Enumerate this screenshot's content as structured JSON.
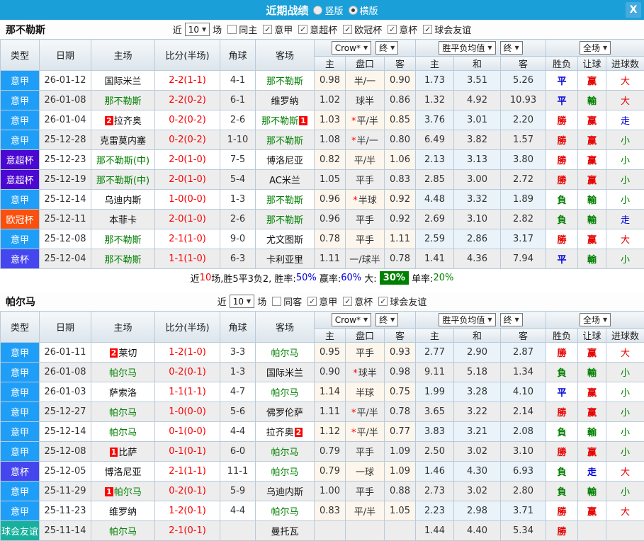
{
  "topbar": {
    "title": "近期战绩",
    "radios": [
      {
        "label": "竖版",
        "checked": false
      },
      {
        "label": "横版",
        "checked": true
      }
    ],
    "close": "X"
  },
  "table_header": {
    "cols": [
      "类型",
      "日期",
      "主场",
      "比分(半场)",
      "角球",
      "客场"
    ],
    "sub": [
      "主",
      "盘口",
      "客",
      "主",
      "和",
      "客",
      "胜负",
      "让球",
      "进球数"
    ],
    "selects": {
      "asian_provider": "Crow*",
      "asian_time": "终",
      "euro_provider": "胜平负均值",
      "euro_time": "终",
      "scope": "全场"
    }
  },
  "colors": {
    "league": {
      "意甲": "#1f9ef7",
      "意超杯": "#4b08d2",
      "欧冠杯": "#fb4f0c",
      "意杯": "#4646ee",
      "球会友谊": "#17b09d"
    },
    "value": {
      "勝": "#e60000",
      "平": "#0000dd",
      "負": "#008000",
      "赢": "#e60000",
      "輸": "#008000",
      "走": "#0000dd",
      "大": "#e60000",
      "小": "#008000"
    }
  },
  "sections": [
    {
      "team": "那不勒斯",
      "filter": {
        "near": "近",
        "count": "10",
        "games": "场",
        "same": {
          "label": "同主",
          "checked": false
        },
        "leagues": [
          {
            "label": "意甲",
            "checked": true
          },
          {
            "label": "意超杯",
            "checked": true
          },
          {
            "label": "欧冠杯",
            "checked": true
          },
          {
            "label": "意杯",
            "checked": true
          },
          {
            "label": "球会友谊",
            "checked": true
          }
        ]
      },
      "rows": [
        {
          "league": "意甲",
          "date": "26-01-12",
          "home": {
            "name": "国际米兰"
          },
          "score": "2-2",
          "half": "(1-1)",
          "corner": "4-1",
          "away": {
            "name": "那不勒斯",
            "green": true
          },
          "asian": [
            "0.98",
            "半/一",
            "0.90"
          ],
          "euro": [
            "1.73",
            "3.51",
            "5.26"
          ],
          "result": "平",
          "let": "赢",
          "goal": "大"
        },
        {
          "league": "意甲",
          "date": "26-01-08",
          "home": {
            "name": "那不勒斯",
            "green": true
          },
          "score": "2-2",
          "half": "(0-2)",
          "corner": "6-1",
          "away": {
            "name": "维罗纳"
          },
          "asian": [
            "1.02",
            "球半",
            "0.86"
          ],
          "euro": [
            "1.32",
            "4.92",
            "10.93"
          ],
          "result": "平",
          "let": "輸",
          "goal": "大"
        },
        {
          "league": "意甲",
          "date": "26-01-04",
          "home": {
            "badge": "2",
            "badge_pos": "before",
            "name": "拉齐奥"
          },
          "score": "0-2",
          "half": "(0-2)",
          "corner": "2-6",
          "away": {
            "name": "那不勒斯",
            "green": true,
            "badge": "1",
            "badge_pos": "after"
          },
          "asian": [
            "1.03",
            "*平/半",
            "0.85"
          ],
          "euro": [
            "3.76",
            "3.01",
            "2.20"
          ],
          "result": "勝",
          "let": "赢",
          "goal": "走"
        },
        {
          "league": "意甲",
          "date": "25-12-28",
          "home": {
            "name": "克雷莫内塞"
          },
          "score": "0-2",
          "half": "(0-2)",
          "corner": "1-10",
          "away": {
            "name": "那不勒斯",
            "green": true
          },
          "asian": [
            "1.08",
            "*半/一",
            "0.80"
          ],
          "euro": [
            "6.49",
            "3.82",
            "1.57"
          ],
          "result": "勝",
          "let": "赢",
          "goal": "小"
        },
        {
          "league": "意超杯",
          "date": "25-12-23",
          "home": {
            "name": "那不勒斯(中)",
            "green": true
          },
          "score": "2-0",
          "half": "(1-0)",
          "corner": "7-5",
          "away": {
            "name": "博洛尼亚"
          },
          "asian": [
            "0.82",
            "平/半",
            "1.06"
          ],
          "euro": [
            "2.13",
            "3.13",
            "3.80"
          ],
          "result": "勝",
          "let": "赢",
          "goal": "小"
        },
        {
          "league": "意超杯",
          "date": "25-12-19",
          "home": {
            "name": "那不勒斯(中)",
            "green": true
          },
          "score": "2-0",
          "half": "(1-0)",
          "corner": "5-4",
          "away": {
            "name": "AC米兰"
          },
          "asian": [
            "1.05",
            "平手",
            "0.83"
          ],
          "euro": [
            "2.85",
            "3.00",
            "2.72"
          ],
          "result": "勝",
          "let": "赢",
          "goal": "小"
        },
        {
          "league": "意甲",
          "date": "25-12-14",
          "home": {
            "name": "乌迪内斯"
          },
          "score": "1-0",
          "half": "(0-0)",
          "corner": "1-3",
          "away": {
            "name": "那不勒斯",
            "green": true
          },
          "asian": [
            "0.96",
            "*半球",
            "0.92"
          ],
          "euro": [
            "4.48",
            "3.32",
            "1.89"
          ],
          "result": "負",
          "let": "輸",
          "goal": "小"
        },
        {
          "league": "欧冠杯",
          "date": "25-12-11",
          "home": {
            "name": "本菲卡"
          },
          "score": "2-0",
          "half": "(1-0)",
          "corner": "2-6",
          "away": {
            "name": "那不勒斯",
            "green": true
          },
          "asian": [
            "0.96",
            "平手",
            "0.92"
          ],
          "euro": [
            "2.69",
            "3.10",
            "2.82"
          ],
          "result": "負",
          "let": "輸",
          "goal": "走"
        },
        {
          "league": "意甲",
          "date": "25-12-08",
          "home": {
            "name": "那不勒斯",
            "green": true
          },
          "score": "2-1",
          "half": "(1-0)",
          "corner": "9-0",
          "away": {
            "name": "尤文图斯"
          },
          "asian": [
            "0.78",
            "平手",
            "1.11"
          ],
          "euro": [
            "2.59",
            "2.86",
            "3.17"
          ],
          "result": "勝",
          "let": "赢",
          "goal": "大"
        },
        {
          "league": "意杯",
          "date": "25-12-04",
          "home": {
            "name": "那不勒斯",
            "green": true
          },
          "score": "1-1",
          "half": "(1-0)",
          "corner": "6-3",
          "away": {
            "name": "卡利亚里"
          },
          "asian": [
            "1.11",
            "一/球半",
            "0.78"
          ],
          "euro": [
            "1.41",
            "4.36",
            "7.94"
          ],
          "result": "平",
          "let": "輸",
          "goal": "小"
        }
      ],
      "summary": [
        {
          "text": "近",
          "color": "#111111"
        },
        {
          "text": "10",
          "color": "#fe0000"
        },
        {
          "text": "场,胜5平3负2, 胜率:",
          "color": "#111111"
        },
        {
          "text": "50%",
          "color": "#0000dd"
        },
        {
          "text": " 赢率:",
          "color": "#111111"
        },
        {
          "text": "60%",
          "color": "#0000dd"
        },
        {
          "text": " 大: ",
          "color": "#111111"
        },
        {
          "text": "30%",
          "color": "#ffffff",
          "bg": "#008000"
        },
        {
          "text": " 单率:",
          "color": "#111111"
        },
        {
          "text": "20%",
          "color": "#008000"
        }
      ]
    },
    {
      "team": "帕尔马",
      "filter": {
        "near": "近",
        "count": "10",
        "games": "场",
        "same": {
          "label": "同客",
          "checked": false
        },
        "leagues": [
          {
            "label": "意甲",
            "checked": true
          },
          {
            "label": "意杯",
            "checked": true
          },
          {
            "label": "球会友谊",
            "checked": true
          }
        ]
      },
      "rows": [
        {
          "league": "意甲",
          "date": "26-01-11",
          "home": {
            "badge": "2",
            "badge_pos": "before",
            "name": "莱切"
          },
          "score": "1-2",
          "half": "(1-0)",
          "corner": "3-3",
          "away": {
            "name": "帕尔马",
            "green": true
          },
          "asian": [
            "0.95",
            "平手",
            "0.93"
          ],
          "euro": [
            "2.77",
            "2.90",
            "2.87"
          ],
          "result": "勝",
          "let": "赢",
          "goal": "大"
        },
        {
          "league": "意甲",
          "date": "26-01-08",
          "home": {
            "name": "帕尔马",
            "green": true
          },
          "score": "0-2",
          "half": "(0-1)",
          "corner": "1-3",
          "away": {
            "name": "国际米兰"
          },
          "asian": [
            "0.90",
            "*球半",
            "0.98"
          ],
          "euro": [
            "9.11",
            "5.18",
            "1.34"
          ],
          "result": "負",
          "let": "輸",
          "goal": "小"
        },
        {
          "league": "意甲",
          "date": "26-01-03",
          "home": {
            "name": "萨索洛"
          },
          "score": "1-1",
          "half": "(1-1)",
          "corner": "4-7",
          "away": {
            "name": "帕尔马",
            "green": true
          },
          "asian": [
            "1.14",
            "半球",
            "0.75"
          ],
          "euro": [
            "1.99",
            "3.28",
            "4.10"
          ],
          "result": "平",
          "let": "赢",
          "goal": "小"
        },
        {
          "league": "意甲",
          "date": "25-12-27",
          "home": {
            "name": "帕尔马",
            "green": true
          },
          "score": "1-0",
          "half": "(0-0)",
          "corner": "5-6",
          "away": {
            "name": "佛罗伦萨"
          },
          "asian": [
            "1.11",
            "*平/半",
            "0.78"
          ],
          "euro": [
            "3.65",
            "3.22",
            "2.14"
          ],
          "result": "勝",
          "let": "赢",
          "goal": "小"
        },
        {
          "league": "意甲",
          "date": "25-12-14",
          "home": {
            "name": "帕尔马",
            "green": true
          },
          "score": "0-1",
          "half": "(0-0)",
          "corner": "4-4",
          "away": {
            "name": "拉齐奥",
            "badge": "2",
            "badge_pos": "after"
          },
          "asian": [
            "1.12",
            "*平/半",
            "0.77"
          ],
          "euro": [
            "3.83",
            "3.21",
            "2.08"
          ],
          "result": "負",
          "let": "輸",
          "goal": "小"
        },
        {
          "league": "意甲",
          "date": "25-12-08",
          "home": {
            "badge": "1",
            "badge_pos": "before",
            "name": "比萨"
          },
          "score": "0-1",
          "half": "(0-1)",
          "corner": "6-0",
          "away": {
            "name": "帕尔马",
            "green": true
          },
          "asian": [
            "0.79",
            "平手",
            "1.09"
          ],
          "euro": [
            "2.50",
            "3.02",
            "3.10"
          ],
          "result": "勝",
          "let": "赢",
          "goal": "小"
        },
        {
          "league": "意杯",
          "date": "25-12-05",
          "home": {
            "name": "博洛尼亚"
          },
          "score": "2-1",
          "half": "(1-1)",
          "corner": "11-1",
          "away": {
            "name": "帕尔马",
            "green": true
          },
          "asian": [
            "0.79",
            "一球",
            "1.09"
          ],
          "euro": [
            "1.46",
            "4.30",
            "6.93"
          ],
          "result": "負",
          "let": "走",
          "goal": "大"
        },
        {
          "league": "意甲",
          "date": "25-11-29",
          "home": {
            "badge": "1",
            "badge_pos": "before",
            "name": "帕尔马",
            "green": true
          },
          "score": "0-2",
          "half": "(0-1)",
          "corner": "5-9",
          "away": {
            "name": "乌迪内斯"
          },
          "asian": [
            "1.00",
            "平手",
            "0.88"
          ],
          "euro": [
            "2.73",
            "3.02",
            "2.80"
          ],
          "result": "負",
          "let": "輸",
          "goal": "小"
        },
        {
          "league": "意甲",
          "date": "25-11-23",
          "home": {
            "name": "维罗纳"
          },
          "score": "1-2",
          "half": "(0-1)",
          "corner": "4-4",
          "away": {
            "name": "帕尔马",
            "green": true
          },
          "asian": [
            "0.83",
            "平/半",
            "1.05"
          ],
          "euro": [
            "2.23",
            "2.98",
            "3.71"
          ],
          "result": "勝",
          "let": "赢",
          "goal": "大"
        },
        {
          "league": "球会友谊",
          "date": "25-11-14",
          "home": {
            "name": "帕尔马",
            "green": true
          },
          "score": "2-1",
          "half": "(0-1)",
          "corner": "",
          "away": {
            "name": "曼托瓦"
          },
          "asian": [
            "",
            "",
            ""
          ],
          "euro": [
            "1.44",
            "4.40",
            "5.34"
          ],
          "result": "勝",
          "let": "",
          "goal": ""
        }
      ],
      "summary": null
    }
  ]
}
